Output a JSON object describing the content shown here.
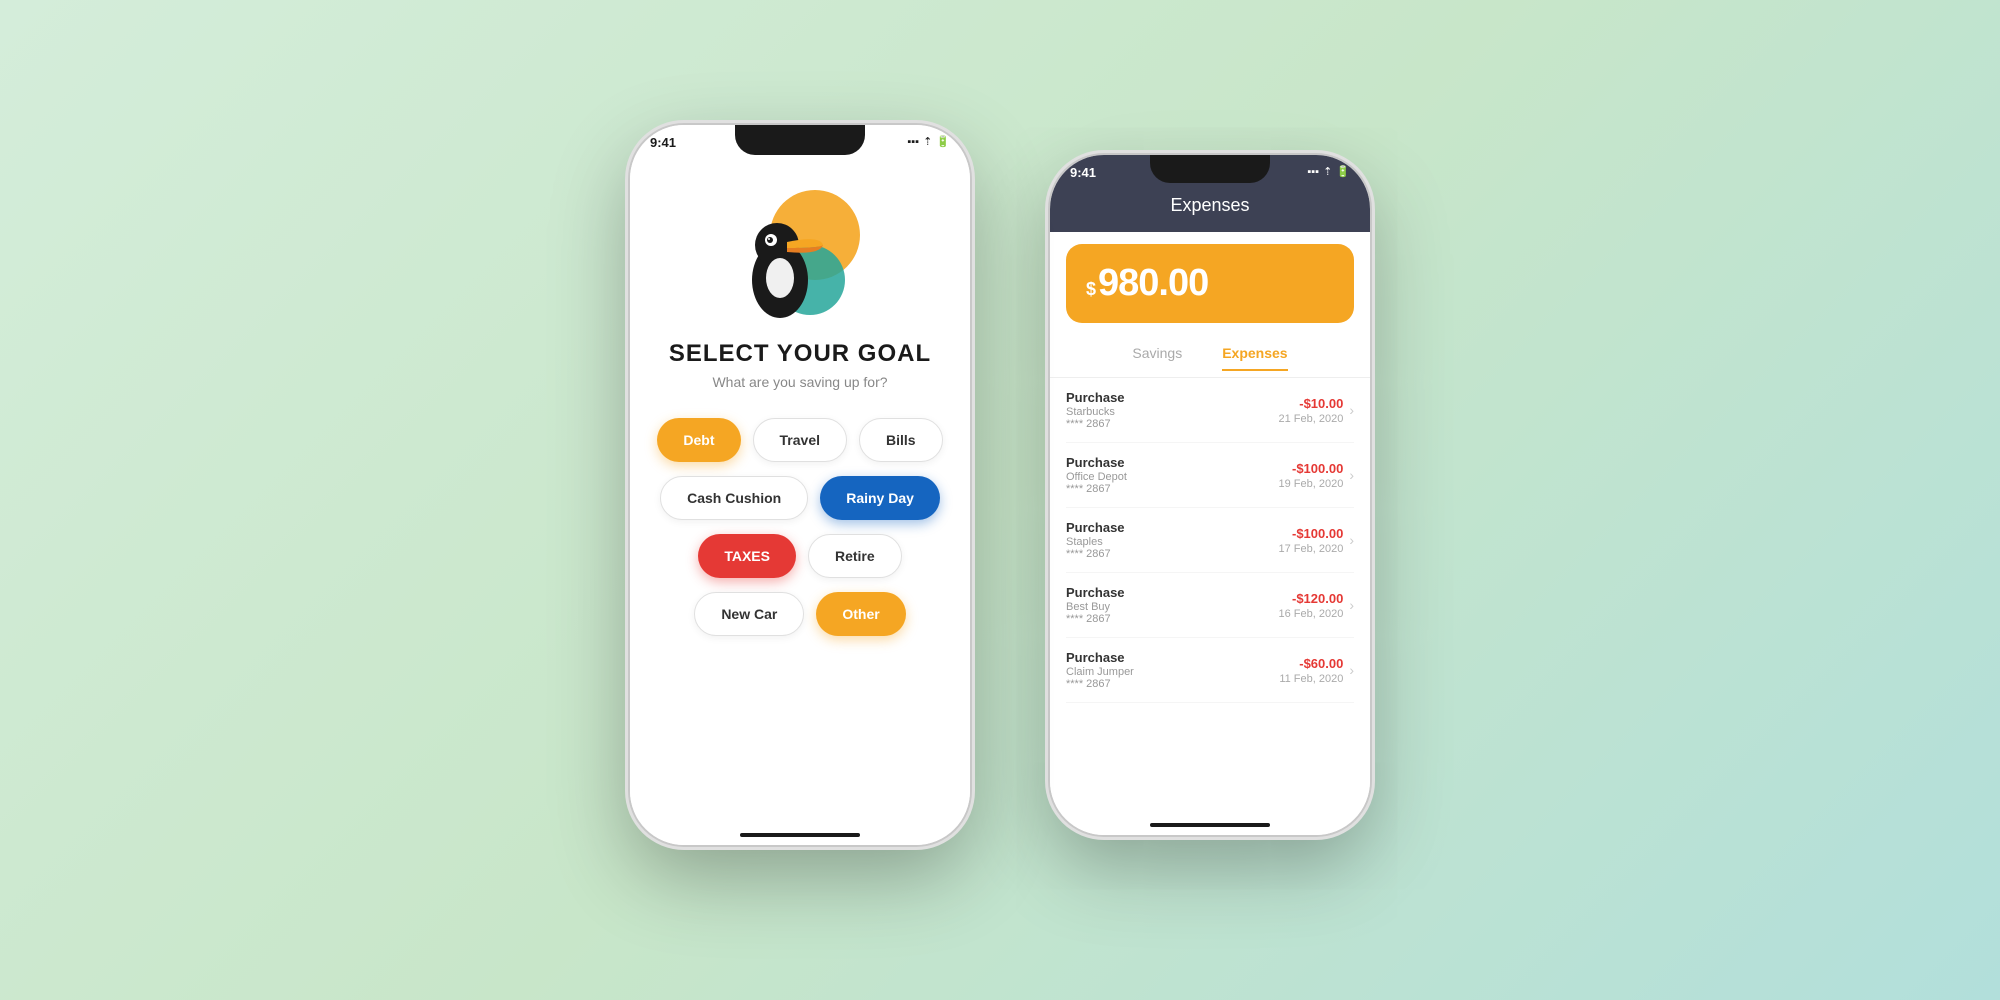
{
  "background": "#c8e6c9",
  "phone1": {
    "statusBar": {
      "time": "9:41",
      "icons": "▪▪▪ ▲ 🔋"
    },
    "title": "SELECT YOUR GOAL",
    "subtitle": "What are you saving up for?",
    "goals": [
      [
        {
          "label": "Debt",
          "style": "orange"
        },
        {
          "label": "Travel",
          "style": "outline"
        },
        {
          "label": "Bills",
          "style": "outline"
        }
      ],
      [
        {
          "label": "Cash Cushion",
          "style": "outline"
        },
        {
          "label": "Rainy Day",
          "style": "blue"
        }
      ],
      [
        {
          "label": "TAXES",
          "style": "red"
        },
        {
          "label": "Retire",
          "style": "outline"
        }
      ],
      [
        {
          "label": "New Car",
          "style": "outline"
        },
        {
          "label": "Other",
          "style": "yellow"
        }
      ]
    ]
  },
  "phone2": {
    "statusBar": {
      "time": "9:41",
      "icons": "▪▪▪ ▲ 🔋"
    },
    "header": {
      "title": "Expenses",
      "amount": "980.00",
      "currency": "$"
    },
    "tabs": [
      {
        "label": "Savings",
        "active": false
      },
      {
        "label": "Expenses",
        "active": true
      }
    ],
    "transactions": [
      {
        "type": "Purchase",
        "merchant": "Starbucks",
        "card": "**** 2867",
        "amount": "-$10.00",
        "date": "21 Feb, 2020"
      },
      {
        "type": "Purchase",
        "merchant": "Office Depot",
        "card": "**** 2867",
        "amount": "-$100.00",
        "date": "19 Feb, 2020"
      },
      {
        "type": "Purchase",
        "merchant": "Staples",
        "card": "**** 2867",
        "amount": "-$100.00",
        "date": "17 Feb, 2020"
      },
      {
        "type": "Purchase",
        "merchant": "Best Buy",
        "card": "**** 2867",
        "amount": "-$120.00",
        "date": "16 Feb, 2020"
      },
      {
        "type": "Purchase",
        "merchant": "Claim Jumper",
        "card": "**** 2867",
        "amount": "-$60.00",
        "date": "11 Feb, 2020"
      }
    ]
  }
}
